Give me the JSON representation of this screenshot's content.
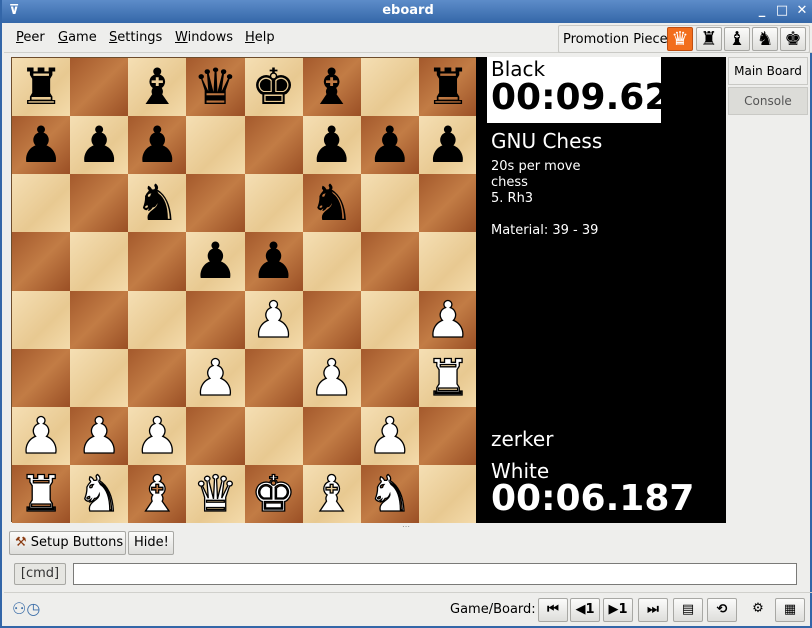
{
  "window": {
    "title": "eboard"
  },
  "menu": {
    "items": [
      {
        "key": "P",
        "rest": "eer"
      },
      {
        "key": "G",
        "rest": "ame"
      },
      {
        "key": "S",
        "rest": "ettings"
      },
      {
        "key": "W",
        "rest": "indows"
      },
      {
        "key": "H",
        "rest": "elp"
      }
    ]
  },
  "promotion": {
    "label": "Promotion Piece",
    "pieces": [
      "♛",
      "♜",
      "♝",
      "♞",
      "♚"
    ],
    "active_index": 0,
    "active_color": "#f26e1c"
  },
  "board": {
    "rows": [
      [
        "br",
        "",
        "bb",
        "bq",
        "bk",
        "bb",
        "",
        "br"
      ],
      [
        "bp",
        "bp",
        "bp",
        "",
        "",
        "bp",
        "bp",
        "bp"
      ],
      [
        "",
        "",
        "bn",
        "",
        "",
        "bn",
        "",
        ""
      ],
      [
        "",
        "",
        "",
        "bp",
        "bp",
        "",
        "",
        ""
      ],
      [
        "",
        "",
        "",
        "",
        "wp",
        "",
        "",
        "wp"
      ],
      [
        "",
        "",
        "",
        "wp",
        "",
        "wp",
        "",
        "wr"
      ],
      [
        "wp",
        "wp",
        "wp",
        "",
        "",
        "",
        "wp",
        ""
      ],
      [
        "wr",
        "wn",
        "wb",
        "wq",
        "wk",
        "wb",
        "wn",
        ""
      ]
    ],
    "glyphs": {
      "k": "♚",
      "q": "♛",
      "r": "♜",
      "b": "♝",
      "n": "♞",
      "p": "♟"
    }
  },
  "info": {
    "black_label": "Black",
    "black_clock": "00:09.62",
    "opponent": "GNU Chess",
    "time_control": "20s per move",
    "variant": "chess",
    "last_move": "5. Rh3",
    "material": "Material: 39 - 39",
    "player": "zerker",
    "white_label": "White",
    "white_clock": "00:06.187"
  },
  "tabs": [
    {
      "label": "Main Board"
    },
    {
      "label": "Console"
    }
  ],
  "buttons": {
    "setup": "Setup Buttons",
    "hide": "Hide!"
  },
  "command": {
    "button": "[cmd]",
    "value": ""
  },
  "status": {
    "game_board_label": "Game/Board:",
    "nav": {
      "first": "⏮",
      "prev": "◀1",
      "next": "▶1",
      "last": "⏭"
    }
  }
}
